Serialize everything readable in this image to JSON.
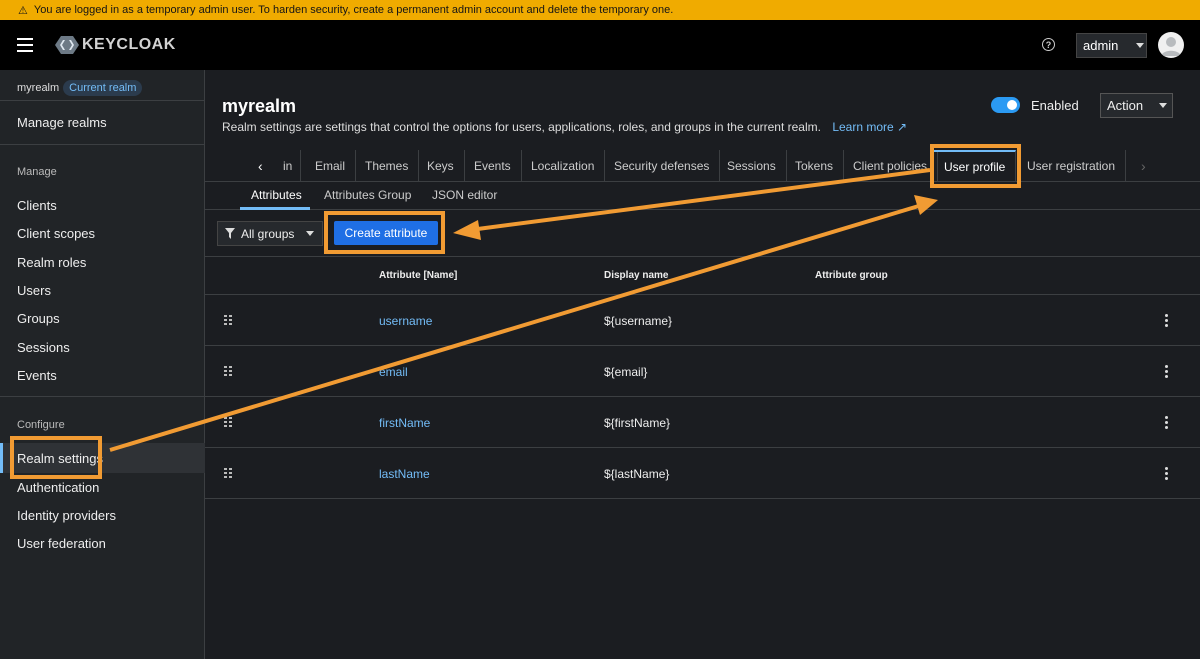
{
  "banner": {
    "icon": "warning-icon",
    "text": "You are logged in as a temporary admin user. To harden security, create a permanent admin account and delete the temporary one."
  },
  "header": {
    "logo_text": "KEYCLOAK",
    "user": "admin"
  },
  "sidebar": {
    "realm": "myrealm",
    "realm_chip": "Current realm",
    "manage_realms": "Manage realms",
    "manage_section": "Manage",
    "manage_items": [
      "Clients",
      "Client scopes",
      "Realm roles",
      "Users",
      "Groups",
      "Sessions",
      "Events"
    ],
    "configure_section": "Configure",
    "configure_items": [
      "Realm settings",
      "Authentication",
      "Identity providers",
      "User federation"
    ]
  },
  "page": {
    "title": "myrealm",
    "description": "Realm settings are settings that control the options for users, applications, roles, and groups in the current realm.",
    "learn_more": "Learn more",
    "enabled_label": "Enabled",
    "action_label": "Action"
  },
  "tabs": [
    "in",
    "Email",
    "Themes",
    "Keys",
    "Events",
    "Localization",
    "Security defenses",
    "Sessions",
    "Tokens",
    "Client policies",
    "User profile",
    "User registration"
  ],
  "subtabs": [
    "Attributes",
    "Attributes Group",
    "JSON editor"
  ],
  "toolbar": {
    "filter_label": "All groups",
    "create_label": "Create attribute"
  },
  "table": {
    "headers": [
      "Attribute [Name]",
      "Display name",
      "Attribute group"
    ],
    "rows": [
      {
        "name": "username",
        "display": "${username}"
      },
      {
        "name": "email",
        "display": "${email}"
      },
      {
        "name": "firstName",
        "display": "${firstName}"
      },
      {
        "name": "lastName",
        "display": "${lastName}"
      }
    ]
  },
  "colors": {
    "annotation": "#f19b33",
    "accent": "#73bcf7",
    "primary": "#1f6fe5",
    "banner": "#f0ab00"
  }
}
